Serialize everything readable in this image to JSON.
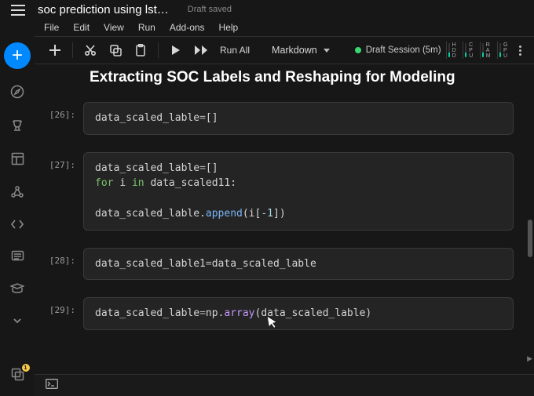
{
  "header": {
    "doc_title": "soc prediction using lst…",
    "draft_saved": "Draft saved"
  },
  "menu": {
    "file": "File",
    "edit": "Edit",
    "view": "View",
    "run": "Run",
    "addons": "Add-ons",
    "help": "Help"
  },
  "toolbar": {
    "run_all": "Run All",
    "cell_type": "Markdown",
    "session": "Draft Session (5m)"
  },
  "resources": {
    "hdd_label": "H\nD\nD",
    "cpu_label": "C\nP\nU",
    "ram_label": "R\nA\nM",
    "gpu_label": "G\nP\nU"
  },
  "notebook": {
    "heading": "Extracting SOC Labels and Reshaping for Modeling",
    "cells": [
      {
        "prompt": "[26]:",
        "lines": [
          [
            {
              "t": "data_scaled_lable"
            },
            {
              "t": "=",
              "cls": "op"
            },
            {
              "t": "[]"
            }
          ]
        ]
      },
      {
        "prompt": "[27]:",
        "lines": [
          [
            {
              "t": "data_scaled_lable"
            },
            {
              "t": "=",
              "cls": "op"
            },
            {
              "t": "[]"
            }
          ],
          [
            {
              "t": "for ",
              "cls": "kw"
            },
            {
              "t": "i "
            },
            {
              "t": "in ",
              "cls": "kw"
            },
            {
              "t": "data_scaled11:"
            }
          ],
          [],
          [
            {
              "t": "    data_scaled_lable."
            },
            {
              "t": "append",
              "cls": "fn"
            },
            {
              "t": "(i["
            },
            {
              "t": "-1",
              "cls": "num"
            },
            {
              "t": "])"
            }
          ]
        ]
      },
      {
        "prompt": "[28]:",
        "lines": [
          [
            {
              "t": "data_scaled_lable1"
            },
            {
              "t": "=",
              "cls": "op"
            },
            {
              "t": "data_scaled_lable"
            }
          ]
        ]
      },
      {
        "prompt": "[29]:",
        "lines": [
          [
            {
              "t": "data_scaled_lable"
            },
            {
              "t": "=",
              "cls": "op"
            },
            {
              "t": "np."
            },
            {
              "t": "array",
              "cls": "npfn"
            },
            {
              "t": "(data_scaled_lable)"
            }
          ]
        ]
      }
    ]
  },
  "sidebar_badge": "1"
}
